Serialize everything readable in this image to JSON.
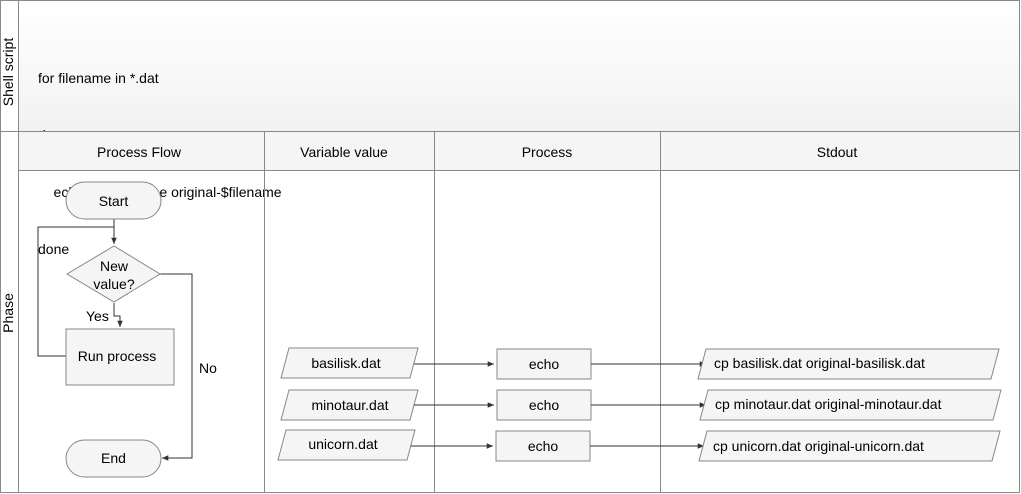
{
  "pools": {
    "shell_script_label": "Shell script",
    "phase_label": "Phase"
  },
  "script": {
    "lines": [
      "for filename in *.dat",
      "do",
      "    echo cp $filename original-$filename",
      "done"
    ]
  },
  "columns": [
    "Process Flow",
    "Variable value",
    "Process",
    "Stdout"
  ],
  "flowchart": {
    "start": "Start",
    "decision_line1": "New",
    "decision_line2": "value?",
    "yes": "Yes",
    "no": "No",
    "process": "Run process",
    "end": "End"
  },
  "rows": [
    {
      "value": "basilisk.dat",
      "process": "echo",
      "stdout": "cp basilisk.dat original-basilisk.dat"
    },
    {
      "value": "minotaur.dat",
      "process": "echo",
      "stdout": "cp minotaur.dat original-minotaur.dat"
    },
    {
      "value": "unicorn.dat",
      "process": "echo",
      "stdout": "cp unicorn.dat original-unicorn.dat"
    }
  ],
  "colors": {
    "border": "#888888",
    "header_fill": "#f5f5f5",
    "shape_fill": "#f5f5f5",
    "arrow": "#333333"
  }
}
